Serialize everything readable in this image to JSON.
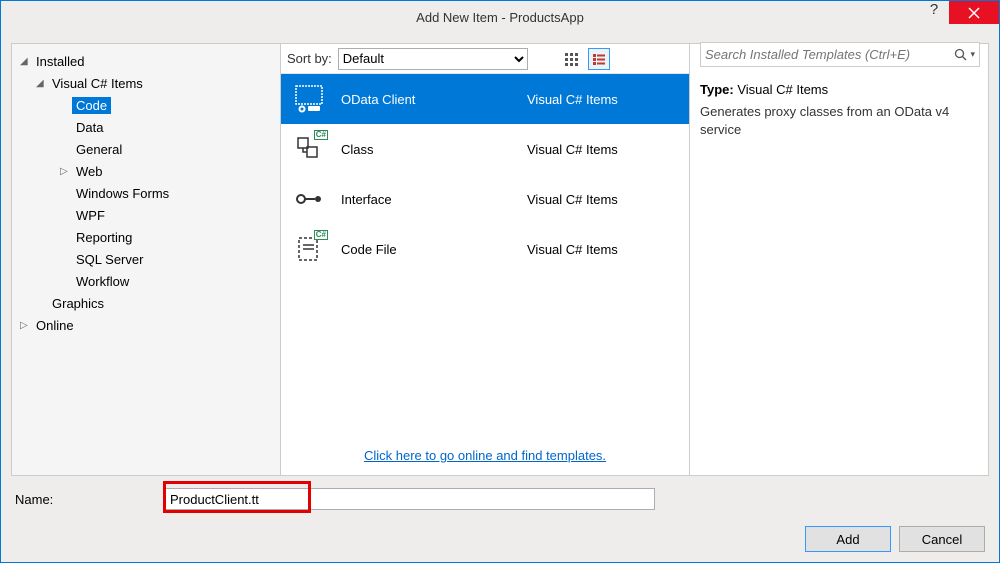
{
  "window": {
    "title": "Add New Item - ProductsApp"
  },
  "tree": {
    "installed": "Installed",
    "csharp_items": "Visual C# Items",
    "code": "Code",
    "data": "Data",
    "general": "General",
    "web": "Web",
    "winforms": "Windows Forms",
    "wpf": "WPF",
    "reporting": "Reporting",
    "sqlserver": "SQL Server",
    "workflow": "Workflow",
    "graphics": "Graphics",
    "online": "Online"
  },
  "toolbar": {
    "sort_by_label": "Sort by:",
    "sort_value": "Default",
    "search_placeholder": "Search Installed Templates (Ctrl+E)"
  },
  "templates": [
    {
      "name": "OData Client",
      "category": "Visual C# Items"
    },
    {
      "name": "Class",
      "category": "Visual C# Items"
    },
    {
      "name": "Interface",
      "category": "Visual C# Items"
    },
    {
      "name": "Code File",
      "category": "Visual C# Items"
    }
  ],
  "online_link": "Click here to go online and find templates.",
  "details": {
    "type_label": "Type:",
    "type_value": "Visual C# Items",
    "description": "Generates proxy classes from an OData v4 service"
  },
  "name_row": {
    "label": "Name:",
    "value": "ProductClient.tt"
  },
  "buttons": {
    "add": "Add",
    "cancel": "Cancel"
  }
}
